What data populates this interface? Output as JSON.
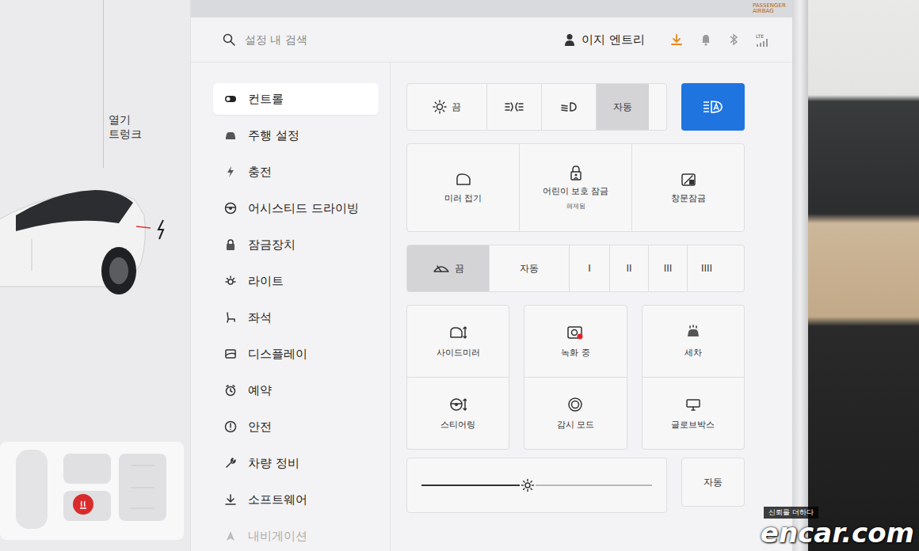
{
  "status": {
    "passenger_airbag": "PASSENGER AIRBAG",
    "network": "LTE"
  },
  "trunk": {
    "action": "열기",
    "label": "트렁크"
  },
  "search": {
    "placeholder": "설정 내 검색"
  },
  "profile": {
    "name": "이지 엔트리"
  },
  "sidebar": {
    "items": [
      {
        "label": "컨트롤",
        "selected": true,
        "faded": false
      },
      {
        "label": "주행 설정",
        "selected": false,
        "faded": false
      },
      {
        "label": "충전",
        "selected": false,
        "faded": false
      },
      {
        "label": "어시스티드 드라이빙",
        "selected": false,
        "faded": false
      },
      {
        "label": "잠금장치",
        "selected": false,
        "faded": false
      },
      {
        "label": "라이트",
        "selected": false,
        "faded": false
      },
      {
        "label": "좌석",
        "selected": false,
        "faded": false
      },
      {
        "label": "디스플레이",
        "selected": false,
        "faded": false
      },
      {
        "label": "예약",
        "selected": false,
        "faded": false
      },
      {
        "label": "안전",
        "selected": false,
        "faded": false
      },
      {
        "label": "차량 정비",
        "selected": false,
        "faded": false
      },
      {
        "label": "소프트웨어",
        "selected": false,
        "faded": false
      },
      {
        "label": "내비게이션",
        "selected": false,
        "faded": true
      }
    ]
  },
  "lights": {
    "options": [
      {
        "kind": "off",
        "label": "끔",
        "selected": false
      },
      {
        "kind": "parking",
        "selected": false
      },
      {
        "kind": "lowbeam",
        "selected": false
      },
      {
        "kind": "auto",
        "label": "자동",
        "selected": true
      }
    ],
    "auto_high_beam": {
      "on": true
    }
  },
  "quick_controls": [
    {
      "label": "미러 접기"
    },
    {
      "label": "어린이 보호 잠금",
      "sub": "해제됨"
    },
    {
      "label": "창문잠금"
    }
  ],
  "wipers": {
    "options": [
      {
        "kind": "off",
        "label": "끔",
        "selected": true
      },
      {
        "kind": "text",
        "label": "자동",
        "selected": false
      },
      {
        "kind": "text",
        "label": "I",
        "selected": false
      },
      {
        "kind": "text",
        "label": "II",
        "selected": false
      },
      {
        "kind": "text",
        "label": "III",
        "selected": false
      },
      {
        "kind": "text",
        "label": "IIII",
        "selected": false
      }
    ]
  },
  "tiles": [
    {
      "label": "사이드미러"
    },
    {
      "label": "스티어링"
    },
    {
      "label": "녹화 중",
      "recording": true
    },
    {
      "label": "감시 모드"
    },
    {
      "label": "세차"
    },
    {
      "label": "글로브박스"
    }
  ],
  "brightness": {
    "level": 0.46,
    "auto_label": "자동"
  },
  "watermark": {
    "tagline": "신뢰를 더하다",
    "brand": "encar.com"
  }
}
